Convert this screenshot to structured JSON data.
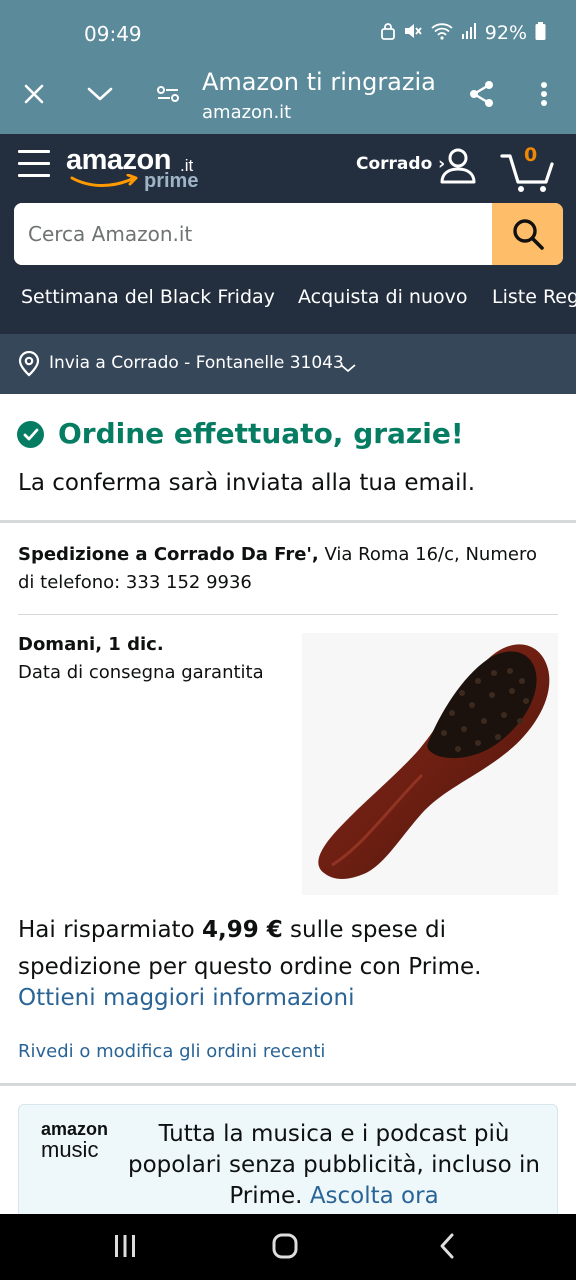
{
  "status_bar": {
    "time": "09:49",
    "battery": "92%",
    "icons": [
      "lock-icon",
      "mute-icon",
      "wifi-icon",
      "signal-icon",
      "battery-icon"
    ]
  },
  "browser": {
    "page_title": "Amazon ti ringrazia",
    "url": "amazon.it",
    "icons": [
      "close-icon",
      "chevron-down-icon",
      "site-settings-icon",
      "share-icon",
      "more-vert-icon"
    ]
  },
  "header": {
    "logo_word": "amazon",
    "logo_tld": ".it",
    "logo_sub": "prime",
    "account_label": "Corrado ›",
    "cart_count": "0",
    "search_placeholder": "Cerca Amazon.it",
    "nav_links": [
      "Settimana del Black Friday",
      "Acquista di nuovo",
      "Liste Reg"
    ]
  },
  "deliver_to": "Invia a Corrado - Fontanelle 31043",
  "order": {
    "title": "Ordine effettuato, grazie!",
    "subtitle": "La conferma sarà inviata alla tua email.",
    "ship_bold": "Spedizione a Corrado Da Fre',",
    "ship_rest": " Via Roma 16/c, Numero di telefono: 333 152 9936",
    "delivery_date": "Domani, 1 dic.",
    "delivery_note": "Data di consegna garantita",
    "savings_pre": "Hai risparmiato ",
    "savings_amount": "4,99 €",
    "savings_post": " sulle spese di spedizione per questo ordine con Prime.",
    "more_info_link": "Ottieni maggiori informazioni",
    "orders_link": "Rivedi o modifica gli ordini recenti"
  },
  "music_promo": {
    "logo_top": "amazon",
    "logo_bottom": "music",
    "text": "Tutta la musica e i podcast più popolari senza pubblicità, incluso in Prime.",
    "cta": "Ascolta ora"
  },
  "colors": {
    "browser_bar": "#5b8a9a",
    "amazon_header": "#232f3e",
    "delivery_bar": "#37475a",
    "search_button": "#febd69",
    "success_green": "#067d62",
    "link_blue": "#2a6496",
    "cart_count": "#f08804"
  }
}
